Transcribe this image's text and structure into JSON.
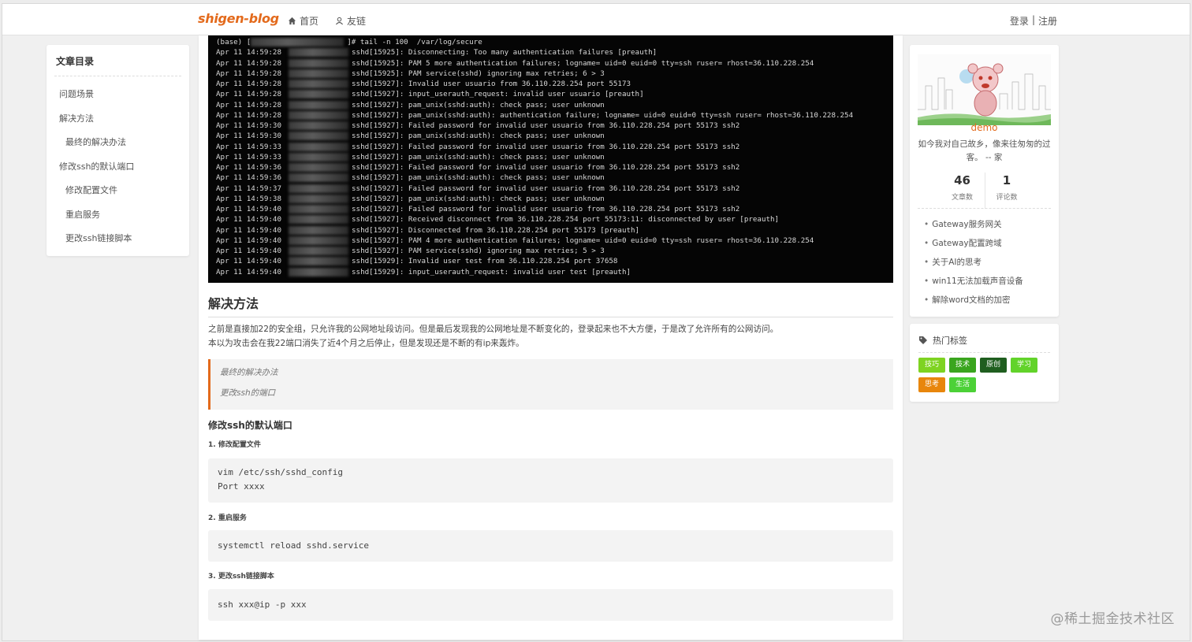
{
  "nav": {
    "logo": "shigen-blog",
    "home": "首页",
    "links": "友链",
    "login": "登录",
    "sep": "|",
    "register": "注册"
  },
  "toc": {
    "title": "文章目录",
    "items": [
      {
        "label": "问题场景",
        "level": 1
      },
      {
        "label": "解决方法",
        "level": 1
      },
      {
        "label": "最终的解决办法",
        "level": 2
      },
      {
        "label": "修改ssh的默认端口",
        "level": 1
      },
      {
        "label": "修改配置文件",
        "level": 2
      },
      {
        "label": "重启服务",
        "level": 2
      },
      {
        "label": "更改ssh链接脚本",
        "level": 2
      }
    ]
  },
  "terminal": {
    "header_prefix": "(base) [",
    "header_cmd": "]# tail -n 100  /var/log/secure",
    "lines": [
      {
        "ts": "Apr 11 14:59:28",
        "msg": "sshd[15925]: Disconnecting: Too many authentication failures [preauth]"
      },
      {
        "ts": "Apr 11 14:59:28",
        "msg": "sshd[15925]: PAM 5 more authentication failures; logname= uid=0 euid=0 tty=ssh ruser= rhost=36.110.228.254"
      },
      {
        "ts": "Apr 11 14:59:28",
        "msg": "sshd[15925]: PAM service(sshd) ignoring max retries; 6 > 3"
      },
      {
        "ts": "Apr 11 14:59:28",
        "msg": "sshd[15927]: Invalid user usuario from 36.110.228.254 port 55173"
      },
      {
        "ts": "Apr 11 14:59:28",
        "msg": "sshd[15927]: input_userauth_request: invalid user usuario [preauth]"
      },
      {
        "ts": "Apr 11 14:59:28",
        "msg": "sshd[15927]: pam_unix(sshd:auth): check pass; user unknown"
      },
      {
        "ts": "Apr 11 14:59:28",
        "msg": "sshd[15927]: pam_unix(sshd:auth): authentication failure; logname= uid=0 euid=0 tty=ssh ruser= rhost=36.110.228.254"
      },
      {
        "ts": "Apr 11 14:59:30",
        "msg": "sshd[15927]: Failed password for invalid user usuario from 36.110.228.254 port 55173 ssh2"
      },
      {
        "ts": "Apr 11 14:59:30",
        "msg": "sshd[15927]: pam_unix(sshd:auth): check pass; user unknown"
      },
      {
        "ts": "Apr 11 14:59:33",
        "msg": "sshd[15927]: Failed password for invalid user usuario from 36.110.228.254 port 55173 ssh2"
      },
      {
        "ts": "Apr 11 14:59:33",
        "msg": "sshd[15927]: pam_unix(sshd:auth): check pass; user unknown"
      },
      {
        "ts": "Apr 11 14:59:36",
        "msg": "sshd[15927]: Failed password for invalid user usuario from 36.110.228.254 port 55173 ssh2"
      },
      {
        "ts": "Apr 11 14:59:36",
        "msg": "sshd[15927]: pam_unix(sshd:auth): check pass; user unknown"
      },
      {
        "ts": "Apr 11 14:59:37",
        "msg": "sshd[15927]: Failed password for invalid user usuario from 36.110.228.254 port 55173 ssh2"
      },
      {
        "ts": "Apr 11 14:59:38",
        "msg": "sshd[15927]: pam_unix(sshd:auth): check pass; user unknown"
      },
      {
        "ts": "Apr 11 14:59:40",
        "msg": "sshd[15927]: Failed password for invalid user usuario from 36.110.228.254 port 55173 ssh2"
      },
      {
        "ts": "Apr 11 14:59:40",
        "msg": "sshd[15927]: Received disconnect from 36.110.228.254 port 55173:11: disconnected by user [preauth]"
      },
      {
        "ts": "Apr 11 14:59:40",
        "msg": "sshd[15927]: Disconnected from 36.110.228.254 port 55173 [preauth]"
      },
      {
        "ts": "Apr 11 14:59:40",
        "msg": "sshd[15927]: PAM 4 more authentication failures; logname= uid=0 euid=0 tty=ssh ruser= rhost=36.110.228.254"
      },
      {
        "ts": "Apr 11 14:59:40",
        "msg": "sshd[15927]: PAM service(sshd) ignoring max retries; 5 > 3"
      },
      {
        "ts": "Apr 11 14:59:40",
        "msg": "sshd[15929]: Invalid user test from 36.110.228.254 port 37658"
      },
      {
        "ts": "Apr 11 14:59:40",
        "msg": "sshd[15929]: input_userauth_request: invalid user test [preauth]"
      }
    ]
  },
  "article": {
    "h2_solution": "解决方法",
    "para1": "之前是直接加22的安全组，只允许我的公网地址段访问。但是最后发现我的公网地址是不断变化的，登录起来也不大方便，于是改了允许所有的公网访问。",
    "para2": "本以为攻击会在我22端口消失了近4个月之后停止，但是发现还是不断的有ip来轰炸。",
    "quote1": "最终的解决办法",
    "quote2": "更改ssh的端口",
    "h3_port": "修改ssh的默认端口",
    "step1": "1. 修改配置文件",
    "code1_line1": "vim /etc/ssh/sshd_config",
    "code1_line2": "Port xxxx",
    "step2": "2. 重启服务",
    "code2_line1": "systemctl reload sshd.service",
    "step3": "3. 更改ssh链接脚本",
    "code3_line1": "ssh xxx@ip -p xxx"
  },
  "profile": {
    "name": "demo",
    "motto": "如今我对自己故乡，像来往匆匆的过客。 -- 家",
    "posts_count": "46",
    "posts_label": "文章数",
    "comments_count": "1",
    "comments_label": "评论数",
    "recent": [
      "Gateway服务网关",
      "Gateway配置跨域",
      "关于AI的思考",
      "win11无法加载声音设备",
      "解除word文档的加密"
    ]
  },
  "tags": {
    "title": "热门标签",
    "items": [
      {
        "label": "技巧",
        "color": "#7ed321"
      },
      {
        "label": "技术",
        "color": "#3aa51e"
      },
      {
        "label": "原创",
        "color": "#1f5e1f"
      },
      {
        "label": "学习",
        "color": "#62d32a"
      },
      {
        "label": "思考",
        "color": "#e8860c"
      },
      {
        "label": "生活",
        "color": "#4cd137"
      }
    ]
  },
  "watermark": "@稀土掘金技术社区",
  "colors": {
    "accent": "#e36a1c"
  }
}
